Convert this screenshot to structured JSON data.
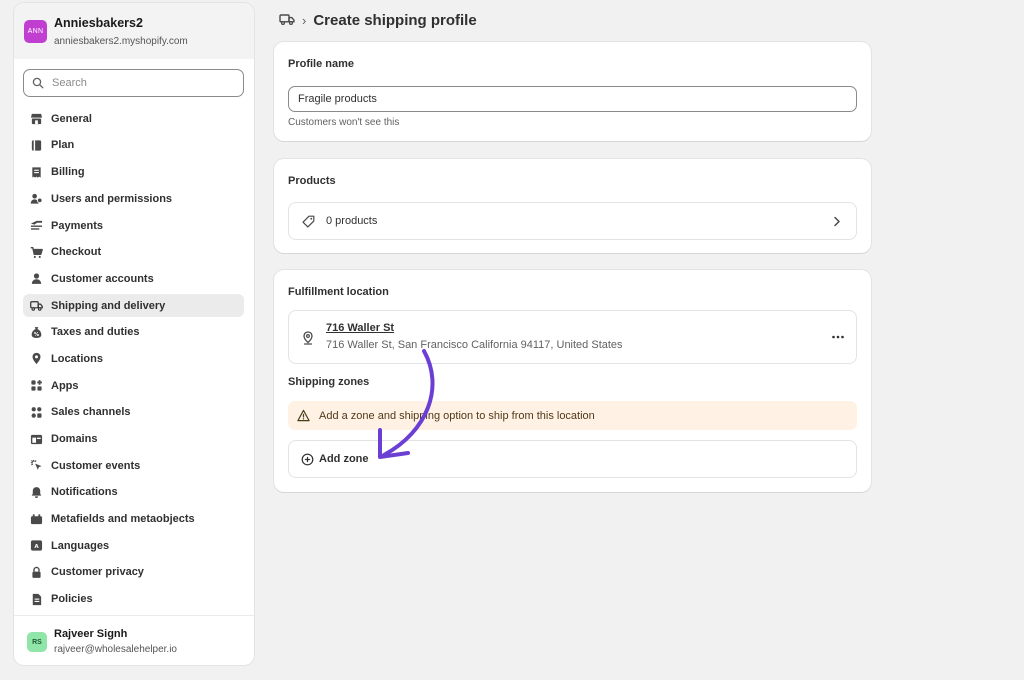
{
  "sidebar": {
    "store": {
      "avatar": "ANN",
      "name": "Anniesbakers2",
      "domain": "anniesbakers2.myshopify.com"
    },
    "search": {
      "placeholder": "Search"
    },
    "items": [
      {
        "label": "General",
        "icon": "store-icon"
      },
      {
        "label": "Plan",
        "icon": "plan-icon"
      },
      {
        "label": "Billing",
        "icon": "receipt-icon"
      },
      {
        "label": "Users and permissions",
        "icon": "users-icon"
      },
      {
        "label": "Payments",
        "icon": "payments-icon"
      },
      {
        "label": "Checkout",
        "icon": "cart-icon"
      },
      {
        "label": "Customer accounts",
        "icon": "person-icon"
      },
      {
        "label": "Shipping and delivery",
        "icon": "truck-icon",
        "active": true
      },
      {
        "label": "Taxes and duties",
        "icon": "tax-icon"
      },
      {
        "label": "Locations",
        "icon": "location-icon"
      },
      {
        "label": "Apps",
        "icon": "apps-icon"
      },
      {
        "label": "Sales channels",
        "icon": "channels-icon"
      },
      {
        "label": "Domains",
        "icon": "domain-icon"
      },
      {
        "label": "Customer events",
        "icon": "cursor-icon"
      },
      {
        "label": "Notifications",
        "icon": "bell-icon"
      },
      {
        "label": "Metafields and metaobjects",
        "icon": "metafields-icon"
      },
      {
        "label": "Languages",
        "icon": "language-icon"
      },
      {
        "label": "Customer privacy",
        "icon": "lock-icon"
      },
      {
        "label": "Policies",
        "icon": "policy-icon"
      }
    ],
    "user": {
      "initials": "RS",
      "name": "Rajveer Signh",
      "email": "rajveer@wholesalehelper.io"
    }
  },
  "header": {
    "separator": "›",
    "title": "Create shipping profile"
  },
  "profile_card": {
    "title": "Profile name",
    "input_value": "Fragile products",
    "help": "Customers won't see this"
  },
  "products_card": {
    "title": "Products",
    "count_label": "0 products"
  },
  "fulfillment_card": {
    "title": "Fulfillment location",
    "location_name": "716 Waller St",
    "location_address": "716 Waller St, San Francisco California 94117, United States",
    "zones_title": "Shipping zones",
    "warning": "Add a zone and shipping option to ship from this location",
    "add_zone_label": "Add zone"
  },
  "colors": {
    "arrow": "#6b3fd4",
    "store_avatar": "#c13fd0",
    "user_avatar": "#90e5a8",
    "warning_bg": "#fff1e3"
  }
}
